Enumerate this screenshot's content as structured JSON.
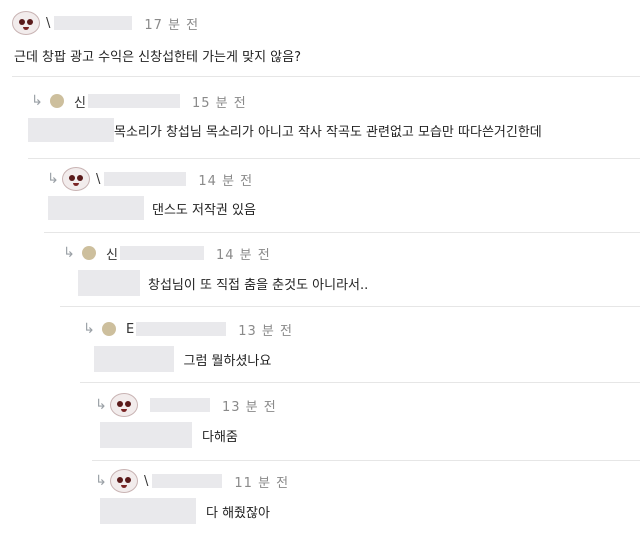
{
  "comments": [
    {
      "name_initial": "\\",
      "time": "17 분 전",
      "text": "근데 창팝 광고 수익은 신창섭한테 가는게 맞지 않음?"
    },
    {
      "name_initial": "신",
      "time": "15 분 전",
      "text": "목소리가 창섭님 목소리가 아니고 작사 작곡도 관련없고 모습만 따다쓴거긴한데"
    },
    {
      "name_initial": "\\",
      "time": "14 분 전",
      "text": "댄스도 저작권 있음"
    },
    {
      "name_initial": "신",
      "time": "14 분 전",
      "text": "창섭님이 또 직접 춤을 춘것도 아니라서.."
    },
    {
      "name_initial": "E",
      "time": "13 분 전",
      "text": "그럼 뭘하셨나요"
    },
    {
      "name_initial": "",
      "time": "13 분 전",
      "text": "다해줌"
    },
    {
      "name_initial": "\\",
      "time": "11 분 전",
      "text": "다 해줬잖아"
    }
  ],
  "icons": {
    "reply": "reply-arrow-icon",
    "avatar_image": "avatar-icon",
    "avatar_default": "default-avatar-icon"
  },
  "colors": {
    "time": "#8a8a8a",
    "blur": "#e9e9ec",
    "avatar_default": "#cdbf9d",
    "separator": "#e6e6e6"
  }
}
